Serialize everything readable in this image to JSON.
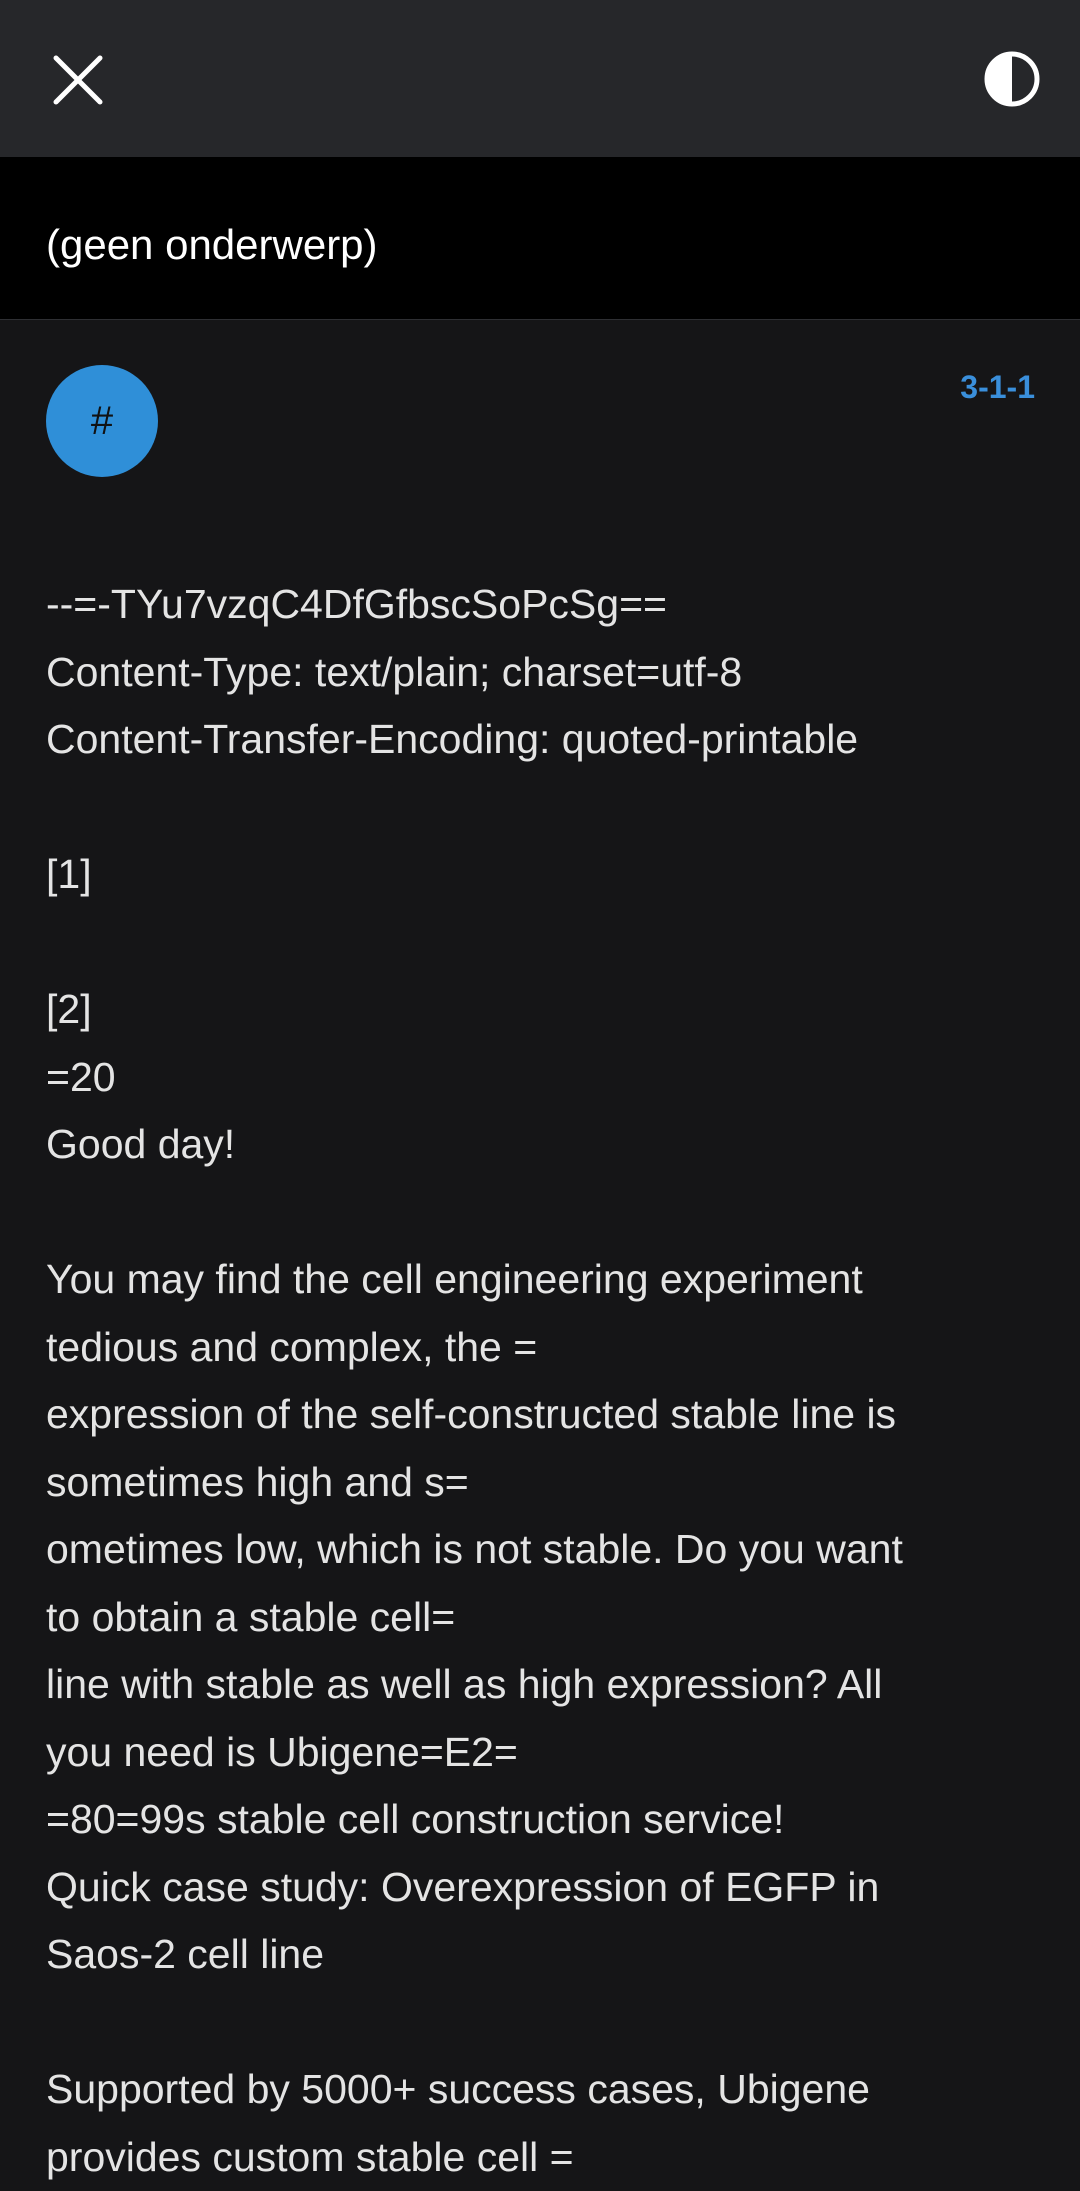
{
  "header": {
    "close_icon": "close-icon",
    "contrast_icon": "contrast-toggle-icon"
  },
  "message": {
    "subject": "(geen onderwerp)",
    "avatar_letter": "#",
    "avatar_color": "#2f8fd8",
    "date": "3-1-1",
    "accent_color": "#3a8fdb",
    "body_lines": [
      "--=-TYu7vzqC4DfGfbscSoPcSg==",
      "Content-Type: text/plain; charset=utf-8",
      "Content-Transfer-Encoding: quoted-printable",
      "",
      "[1]",
      "",
      "[2]",
      "=20",
      "Good day!",
      "",
      "You may find the cell engineering experiment",
      "tedious and complex, the =",
      "expression of the self-constructed stable line is",
      "sometimes high and s=",
      "ometimes low, which is not stable. Do you want",
      "to obtain a stable cell=",
      "line with stable as well as high expression? All",
      "you need is Ubigene=E2=",
      "=80=99s stable cell construction service!",
      "Quick case study: Overexpression of EGFP in",
      "Saos-2 cell line",
      "",
      "Supported by 5000+ success cases, Ubigene",
      "provides custom stable cell ="
    ]
  }
}
